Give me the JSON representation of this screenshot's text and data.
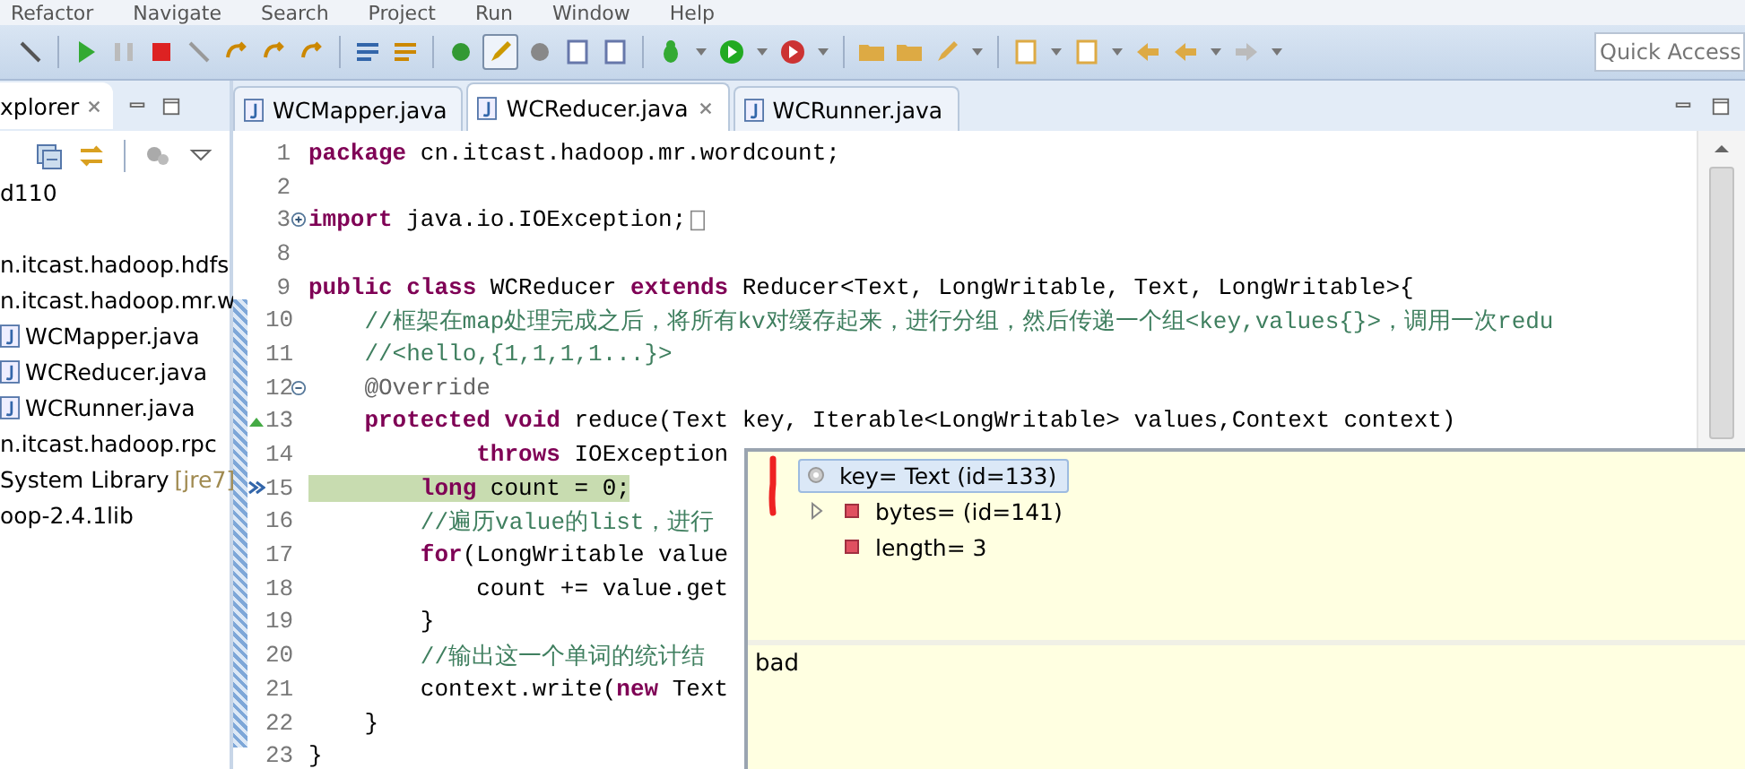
{
  "menu": [
    "Refactor",
    "Navigate",
    "Search",
    "Project",
    "Run",
    "Window",
    "Help"
  ],
  "quick_access": {
    "placeholder": "Quick Access"
  },
  "explorer": {
    "tab": "xplorer",
    "tree": [
      {
        "label": "d110"
      },
      {
        "label": "n.itcast.hadoop.hdfs"
      },
      {
        "label": "n.itcast.hadoop.mr.w",
        "children": [
          {
            "label": "WCMapper.java"
          },
          {
            "label": "WCReducer.java"
          },
          {
            "label": "WCRunner.java"
          }
        ]
      },
      {
        "label": "n.itcast.hadoop.rpc"
      },
      {
        "label": "System Library",
        "decoration": "[jre7]"
      },
      {
        "label": "oop-2.4.1lib"
      }
    ]
  },
  "editor_tabs": [
    {
      "label": "WCMapper.java",
      "selected": false
    },
    {
      "label": "WCReducer.java",
      "selected": true
    },
    {
      "label": "WCRunner.java",
      "selected": false
    }
  ],
  "code": [
    {
      "number": "1",
      "segments": [
        {
          "kind": "kw",
          "s": "package"
        },
        {
          "kind": "plain",
          "s": " cn.itcast.hadoop.mr.wordcount;"
        }
      ]
    },
    {
      "number": "2"
    },
    {
      "number": "3",
      "folded": true,
      "segments": [
        {
          "kind": "kw",
          "s": "import"
        },
        {
          "kind": "plain",
          "s": " java.io.IOException;"
        }
      ]
    },
    {
      "number": "8"
    },
    {
      "number": "9",
      "segments": [
        {
          "kind": "kw",
          "s": "public class"
        },
        {
          "kind": "plain",
          "s": " WCReducer "
        },
        {
          "kind": "kw",
          "s": "extends"
        },
        {
          "kind": "plain",
          "s": " Reducer<Text, LongWritable, Text, LongWritable>{"
        }
      ]
    },
    {
      "number": "10",
      "segments": [
        {
          "kind": "comment",
          "s": "    //框架在map处理完成之后，将所有kv对缓存起来，进行分组，然后传递一个组<key,values{}>，调用一次redu"
        }
      ]
    },
    {
      "number": "11",
      "segments": [
        {
          "kind": "comment",
          "s": "    //<hello,{1,1,1,1...}>"
        }
      ]
    },
    {
      "number": "12",
      "segments": [
        {
          "kind": "ann",
          "s": "    @Override"
        }
      ]
    },
    {
      "number": "13",
      "segments": [
        {
          "kind": "kw",
          "s": "    protected void"
        },
        {
          "kind": "plain",
          "s": " reduce(Text key, Iterable<LongWritable> values,Context context)"
        }
      ]
    },
    {
      "number": "14",
      "segments": [
        {
          "kind": "kw",
          "s": "            throws"
        },
        {
          "kind": "plain",
          "s": " IOException"
        }
      ]
    },
    {
      "number": "15",
      "current": true,
      "segments": [
        {
          "kind": "kw",
          "s": "        long"
        },
        {
          "kind": "plain",
          "s": " count = 0;"
        }
      ]
    },
    {
      "number": "16",
      "segments": [
        {
          "kind": "comment",
          "s": "        //遍历value的list，进行"
        }
      ]
    },
    {
      "number": "17",
      "segments": [
        {
          "kind": "kw",
          "s": "        for"
        },
        {
          "kind": "plain",
          "s": "(LongWritable value"
        }
      ]
    },
    {
      "number": "18",
      "segments": [
        {
          "kind": "plain",
          "s": "            count += value.get"
        }
      ]
    },
    {
      "number": "19",
      "segments": [
        {
          "kind": "plain",
          "s": "        }"
        }
      ]
    },
    {
      "number": "20",
      "segments": [
        {
          "kind": "comment",
          "s": "        //输出这一个单词的统计结"
        }
      ]
    },
    {
      "number": "21",
      "segments": [
        {
          "kind": "plain",
          "s": "        context.write("
        },
        {
          "kind": "kw",
          "s": "new"
        },
        {
          "kind": "plain",
          "s": " Text"
        }
      ]
    },
    {
      "number": "22",
      "segments": [
        {
          "kind": "plain",
          "s": "    }"
        }
      ]
    },
    {
      "number": "23",
      "segments": [
        {
          "kind": "plain",
          "s": "}"
        }
      ]
    }
  ],
  "inspector": {
    "variables": [
      {
        "label": "key= Text  (id=133)",
        "kind": "local",
        "selected": true,
        "children": [
          {
            "label": "bytes= (id=141)",
            "kind": "field",
            "selected": false,
            "expanded": false
          },
          {
            "label": "length= 3",
            "kind": "field",
            "selected": false
          }
        ]
      }
    ],
    "detail": "bad"
  }
}
